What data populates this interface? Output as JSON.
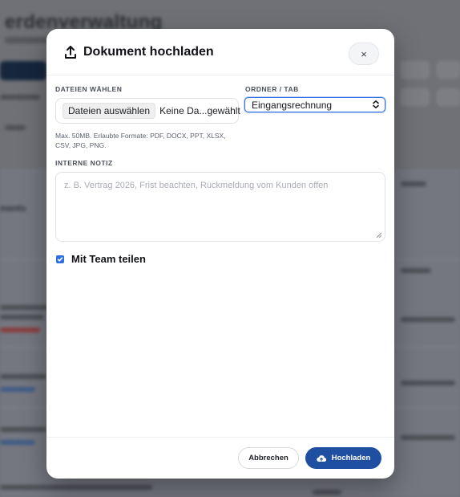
{
  "background": {
    "app_title": "erdenverwaltung"
  },
  "modal": {
    "title": "Dokument hochladen",
    "close_label": "×",
    "files": {
      "label": "DATEIEN WÄHLEN",
      "choose_label": "Dateien auswählen",
      "status": "Keine Da...gewählt",
      "hint": "Max. 50MB. Erlaubte Formate: PDF, DOCX, PPT, XLSX, CSV, JPG, PNG."
    },
    "folder": {
      "label": "ORDNER / TAB",
      "selected": "Eingangsrechnung"
    },
    "note": {
      "label": "INTERNE NOTIZ",
      "placeholder": "z. B. Vertrag 2026, Frist beachten, Rückmeldung vom Kunden offen"
    },
    "share": {
      "checked": true,
      "label": "Mit Team teilen"
    },
    "footer": {
      "cancel_label": "Abbrechen",
      "upload_label": "Hochladen"
    }
  },
  "colors": {
    "accent": "#2f6fe0",
    "primary_button": "#1e4fa0"
  }
}
